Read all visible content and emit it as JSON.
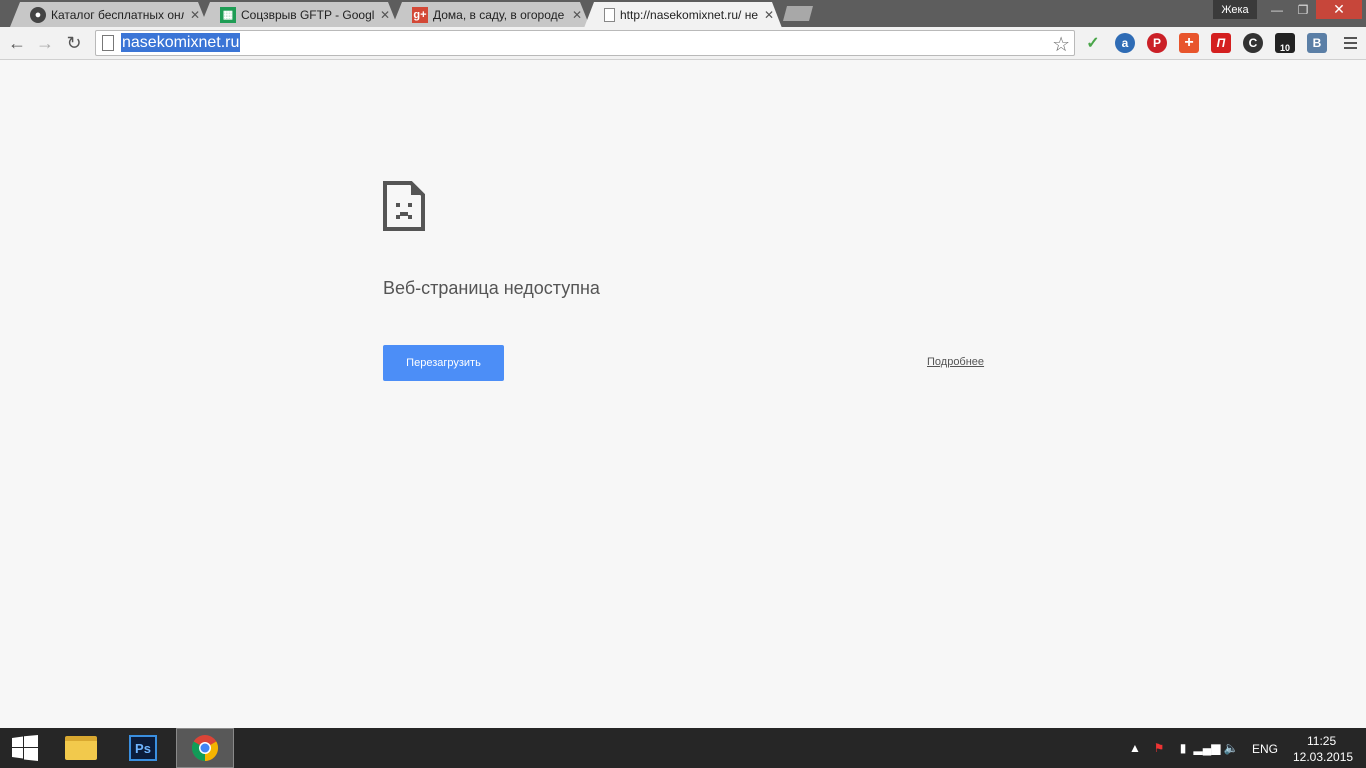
{
  "tabs": [
    {
      "title": "Каталог бесплатных онлайн",
      "icon": "github-icon",
      "active": false
    },
    {
      "title": "Соцзврыв GFTP - Google",
      "icon": "sheets-icon",
      "active": false
    },
    {
      "title": "Дома, в саду, в огороде",
      "icon": "google-plus-icon",
      "active": false
    },
    {
      "title": "http://nasekomixnet.ru/ не",
      "icon": "page-icon",
      "active": true
    }
  ],
  "window": {
    "user": "Жека"
  },
  "omnibox": {
    "url": "nasekomixnet.ru"
  },
  "extensions": [
    {
      "name": "adguard-icon",
      "label": "✓",
      "color": "#4aa64a"
    },
    {
      "name": "amazon-icon",
      "label": "a",
      "color": "#2f6cb5"
    },
    {
      "name": "pinterest-icon",
      "label": "P",
      "color": "#cb2027"
    },
    {
      "name": "plus-extension-icon",
      "label": "+",
      "color": "#e8552c"
    },
    {
      "name": "extension-p-icon",
      "label": "П",
      "color": "#d42020"
    },
    {
      "name": "refresh-extension-icon",
      "label": "C",
      "color": "#333333"
    },
    {
      "name": "screenshot-extension-icon",
      "label": "10",
      "color": "#222222"
    },
    {
      "name": "vk-icon",
      "label": "B",
      "color": "#5b7fa6"
    }
  ],
  "error": {
    "title": "Веб-страница недоступна",
    "reload_label": "Перезагрузить",
    "details_label": "Подробнее"
  },
  "taskbar": {
    "language": "ENG",
    "time": "11:25",
    "date": "12.03.2015"
  }
}
